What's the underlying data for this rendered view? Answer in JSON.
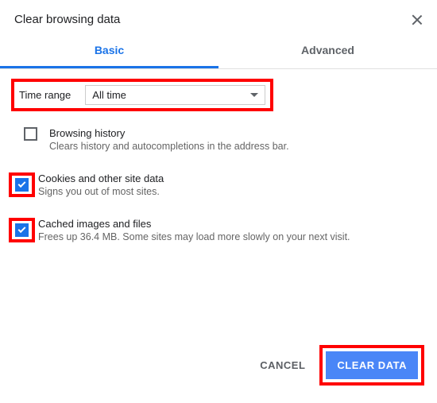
{
  "header": {
    "title": "Clear browsing data"
  },
  "tabs": {
    "basic": "Basic",
    "advanced": "Advanced"
  },
  "timerange": {
    "label": "Time range",
    "value": "All time"
  },
  "options": [
    {
      "title": "Browsing history",
      "desc": "Clears history and autocompletions in the address bar.",
      "checked": false,
      "highlight": false
    },
    {
      "title": "Cookies and other site data",
      "desc": "Signs you out of most sites.",
      "checked": true,
      "highlight": true
    },
    {
      "title": "Cached images and files",
      "desc": "Frees up 36.4 MB. Some sites may load more slowly on your next visit.",
      "checked": true,
      "highlight": true
    }
  ],
  "footer": {
    "cancel": "CANCEL",
    "clear": "CLEAR DATA"
  }
}
